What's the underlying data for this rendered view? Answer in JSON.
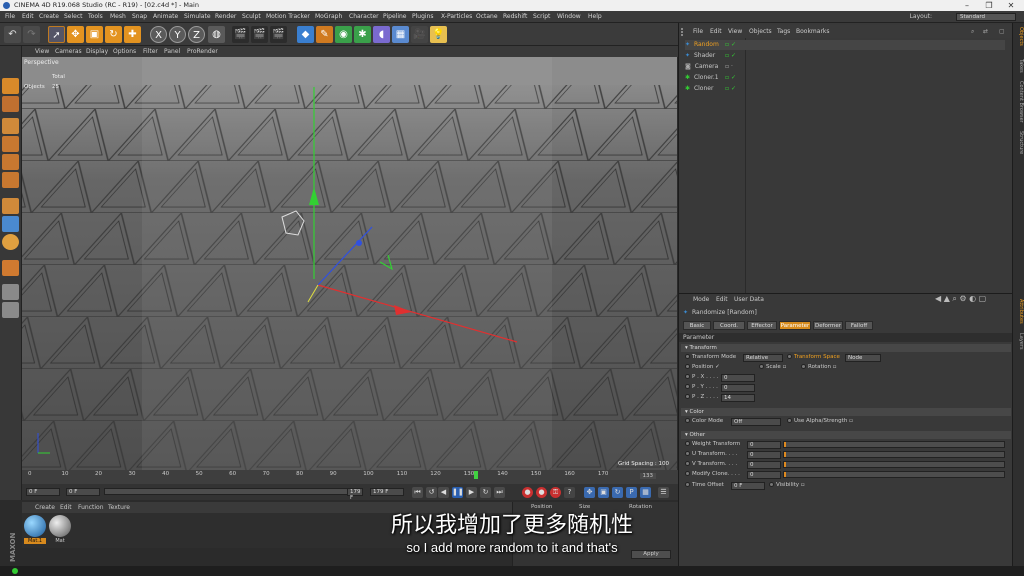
{
  "window": {
    "title": "CINEMA 4D R19.068 Studio (RC - R19) - [02.c4d *] - Main",
    "controls": [
      "–",
      "❐",
      "✕"
    ]
  },
  "menu": [
    "File",
    "Edit",
    "Create",
    "Select",
    "Tools",
    "Mesh",
    "Snap",
    "Animate",
    "Simulate",
    "Render",
    "Sculpt",
    "Motion Tracker",
    "MoGraph",
    "Character",
    "Pipeline",
    "Plugins",
    "X-Particles",
    "Octane",
    "Redshift",
    "Script",
    "Window",
    "Help"
  ],
  "layout": {
    "label": "Layout:",
    "value": "Standard"
  },
  "toolbar": {
    "icons": [
      "undo-icon",
      "redo-icon",
      "select-icon",
      "move-icon",
      "scale-icon",
      "rotate-icon",
      "add-icon",
      "x-axis-icon",
      "y-axis-icon",
      "z-axis-icon",
      "world-icon",
      "render-region-icon",
      "render-view-icon",
      "render-settings-icon",
      "cube-icon",
      "pen-icon",
      "subdivision-icon",
      "cloner-icon",
      "deformer-icon",
      "floor-icon",
      "camera-icon",
      "light-icon"
    ],
    "axis_labels": [
      "X",
      "Y",
      "Z"
    ]
  },
  "viewport": {
    "menu": [
      "View",
      "Cameras",
      "Display",
      "Options",
      "Filter",
      "Panel",
      "ProRender"
    ],
    "camera": "Perspective",
    "stats": {
      "total_label": "Total",
      "objects_label": "Objects",
      "objects_value": "25"
    },
    "grid_spacing": "Grid Spacing : 100"
  },
  "timeline": {
    "ticks": [
      "0",
      "10",
      "20",
      "30",
      "40",
      "50",
      "60",
      "70",
      "80",
      "90",
      "100",
      "110",
      "120",
      "130",
      "140",
      "150",
      "160",
      "170"
    ],
    "current_frame": "133",
    "frame_field": "0 F",
    "start_field": "0 F",
    "end_field": "179 F",
    "end_field2": "179 F",
    "playhead_frame": 133,
    "frame_max": 179
  },
  "materials": {
    "menu": [
      "Create",
      "Edit",
      "Function",
      "Texture"
    ],
    "items": [
      "Mat.1",
      "Mat"
    ]
  },
  "coords": {
    "headers": [
      "Position",
      "Size",
      "Rotation"
    ],
    "apply": "Apply"
  },
  "object_manager": {
    "menu": [
      "File",
      "Edit",
      "View",
      "Objects",
      "Tags",
      "Bookmarks"
    ],
    "objects": [
      {
        "name": "Random",
        "icon": "random-effector-icon",
        "selected": true
      },
      {
        "name": "Shader",
        "icon": "shader-effector-icon",
        "selected": false
      },
      {
        "name": "Camera",
        "icon": "camera-icon",
        "selected": false
      },
      {
        "name": "Cloner.1",
        "icon": "cloner-icon",
        "selected": false
      },
      {
        "name": "Cloner",
        "icon": "cloner-icon",
        "selected": false
      }
    ]
  },
  "attribute_manager": {
    "menu": [
      "Mode",
      "Edit",
      "User Data"
    ],
    "title": "Randomize [Random]",
    "tabs": [
      "Basic",
      "Coord.",
      "Effector",
      "Parameter",
      "Deformer",
      "Falloff"
    ],
    "active_tab": "Parameter",
    "section_title": "Parameter",
    "transform": {
      "header": "Transform",
      "mode_label": "Transform Mode",
      "mode_value": "Relative",
      "space_label": "Transform Space",
      "space_value": "Node",
      "position_label": "Position",
      "scale_label": "Scale",
      "rotation_label": "Rotation",
      "px_label": "P . X . . . .",
      "px_value": "0",
      "py_label": "P . Y . . . .",
      "py_value": "0",
      "pz_label": "P . Z . . . .",
      "pz_value": "14"
    },
    "color": {
      "header": "Color",
      "mode_label": "Color Mode",
      "mode_value": "Off",
      "alpha_label": "Use Alpha/Strength"
    },
    "other": {
      "header": "Other",
      "rows": [
        {
          "label": "Weight Transform",
          "value": "0"
        },
        {
          "label": "U Transform. . . .",
          "value": "0"
        },
        {
          "label": "V Transform. . . .",
          "value": "0"
        },
        {
          "label": "Modify Clone. . . .",
          "value": "0"
        }
      ],
      "time_offset_label": "Time Offset",
      "time_offset_value": "0 F",
      "visibility_label": "Visibility"
    }
  },
  "right_tabs": [
    "Objects",
    "Takes",
    "Content Browser",
    "Structure",
    "Attributes",
    "Layers"
  ],
  "subtitles": {
    "cn": "所以我增加了更多随机性",
    "en": "so I add more random to it and that's"
  },
  "colors": {
    "accent": "#e08a1f",
    "selected_text": "#f0a020",
    "bg": "#393939"
  }
}
